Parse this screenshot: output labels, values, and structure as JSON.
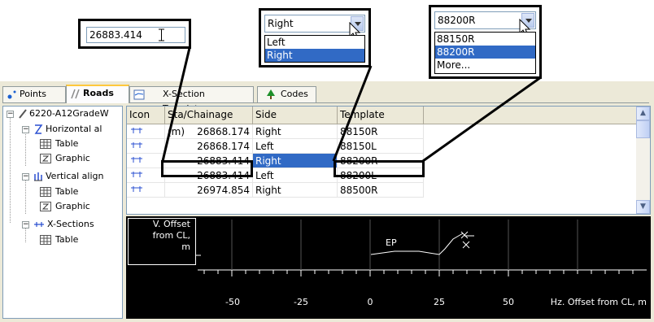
{
  "callouts": {
    "sta_input": {
      "value": "26883.414"
    },
    "side_dropdown": {
      "selected": "Right",
      "options": [
        "Left",
        "Right"
      ],
      "highlighted": "Right"
    },
    "template_dropdown": {
      "selected": "88200R",
      "options": [
        "88150R",
        "88200R",
        "More..."
      ],
      "highlighted": "88200R"
    }
  },
  "tabs": [
    {
      "label": "Points",
      "icon": "points-icon",
      "active": false
    },
    {
      "label": "Roads",
      "icon": "roads-icon",
      "active": true
    },
    {
      "label": "X-Section Templates",
      "icon": "xsection-templates-icon",
      "active": false
    },
    {
      "label": "Codes",
      "icon": "codes-icon",
      "active": false
    }
  ],
  "tree": {
    "root": "6220-A12GradeW",
    "horizontal": "Horizontal al",
    "h_table": "Table",
    "h_graphic": "Graphic",
    "vertical": "Vertical align",
    "v_table": "Table",
    "v_graphic": "Graphic",
    "xsections": "X-Sections",
    "x_table": "Table"
  },
  "grid": {
    "columns": [
      "Icon",
      "Sta/Chainage (m)",
      "Side",
      "Template"
    ],
    "rows": [
      {
        "sta": "26868.174",
        "side": "Right",
        "template": "88150R",
        "selected": false
      },
      {
        "sta": "26868.174",
        "side": "Left",
        "template": "88150L",
        "selected": false
      },
      {
        "sta": "26883.414",
        "side": "Right",
        "template": "88200R",
        "selected": true
      },
      {
        "sta": "26883.414",
        "side": "Left",
        "template": "88200L",
        "selected": false
      },
      {
        "sta": "26974.854",
        "side": "Right",
        "template": "88500R",
        "selected": false
      }
    ]
  },
  "plot": {
    "ylabel_line1": "V. Offset",
    "ylabel_line2": "from CL,",
    "ylabel_line3": "m",
    "xlabel": "Hz. Offset from CL, m",
    "ticks": [
      "-50",
      "-25",
      "0",
      "25",
      "50"
    ],
    "annotation": "EP"
  }
}
